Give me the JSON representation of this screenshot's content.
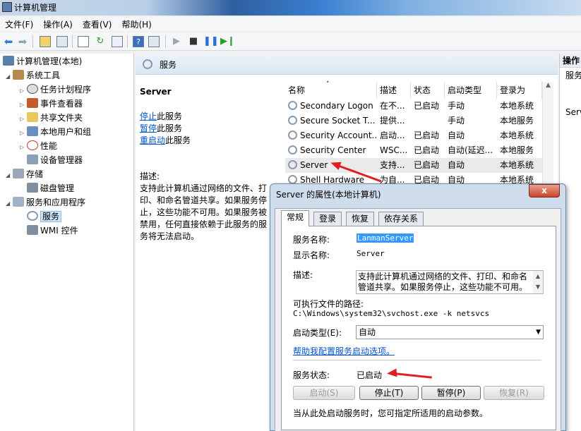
{
  "window": {
    "title": "计算机管理"
  },
  "menu": [
    "文件(F)",
    "操作(A)",
    "查看(V)",
    "帮助(H)"
  ],
  "toolbar": {
    "icons": [
      "back-icon",
      "forward-icon",
      "up-folder-icon",
      "show-hide-tree-icon",
      "properties-icon",
      "refresh-icon",
      "export-icon",
      "help-icon",
      "show-hide-action-icon",
      "play-icon",
      "stop-icon",
      "pause-icon",
      "restart-icon"
    ]
  },
  "tree": {
    "root": "计算机管理(本地)",
    "system_tools": "系统工具",
    "task_scheduler": "任务计划程序",
    "event_viewer": "事件查看器",
    "shared_folders": "共享文件夹",
    "local_users": "本地用户和组",
    "performance": "性能",
    "device_manager": "设备管理器",
    "storage": "存储",
    "disk_management": "磁盘管理",
    "services_apps": "服务和应用程序",
    "services": "服务",
    "wmi": "WMI 控件"
  },
  "main": {
    "header": "服务",
    "service_name": "Server",
    "stop_link": "停止",
    "stop_suffix": "此服务",
    "pause_link": "暂停",
    "pause_suffix": "此服务",
    "restart_link": "重启动",
    "restart_suffix": "此服务",
    "desc_label": "描述:",
    "desc_text": "支持此计算机通过网络的文件、打印、和命名管道共享。如果服务停止，这些功能不可用。如果服务被禁用，任何直接依赖于此服务的服务将无法启动。"
  },
  "list": {
    "columns": [
      "名称",
      "描述",
      "状态",
      "启动类型",
      "登录为"
    ],
    "rows": [
      [
        "Secondary Logon",
        "在不...",
        "已启动",
        "手动",
        "本地系统"
      ],
      [
        "Secure Socket T...",
        "提供...",
        "",
        "手动",
        "本地服务"
      ],
      [
        "Security Account...",
        "启动...",
        "已启动",
        "自动",
        "本地系统"
      ],
      [
        "Security Center",
        "WSC...",
        "已启动",
        "自动(延迟...",
        "本地服务"
      ],
      [
        "Server",
        "支持...",
        "已启动",
        "自动",
        "本地系统"
      ],
      [
        "Shell Hardware",
        "为自...",
        "已启动",
        "自动",
        "本地系统"
      ]
    ]
  },
  "actions": {
    "header": "操作",
    "item1": "服务",
    "item2": "Serv"
  },
  "dialog": {
    "title": "Server 的属性(本地计算机)",
    "close": "x",
    "tabs": [
      "常规",
      "登录",
      "恢复",
      "依存关系"
    ],
    "svc_name_label": "服务名称:",
    "svc_name_value": "LanmanServer",
    "display_label": "显示名称:",
    "display_value": "Server",
    "desc_label": "描述:",
    "desc_value": "支持此计算机通过网络的文件、打印、和命名管道共享。如果服务停止，这些功能不可用。",
    "path_label": "可执行文件的路径:",
    "path_value": "C:\\Windows\\system32\\svchost.exe -k netsvcs",
    "startup_label": "启动类型(E):",
    "startup_value": "自动",
    "help_link": "帮助我配置服务启动选项。",
    "status_label": "服务状态:",
    "status_value": "已启动",
    "btn_start": "启动(S)",
    "btn_stop": "停止(T)",
    "btn_pause": "暂停(P)",
    "btn_resume": "恢复(R)",
    "hint": "当从此处启动服务时，您可指定所适用的启动参数。"
  }
}
